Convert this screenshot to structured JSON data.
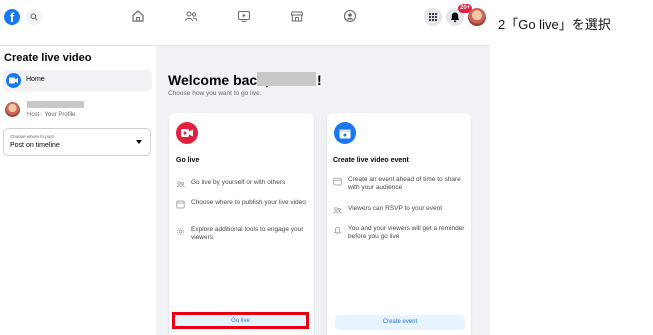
{
  "header": {
    "brand_letter": "f",
    "notification_count": "20+",
    "icons": [
      "facebook-logo-icon",
      "search-icon",
      "home-icon",
      "friends-icon",
      "watch-icon",
      "marketplace-icon",
      "groups-icon",
      "menu-grid-icon",
      "messenger-icon",
      "notifications-icon",
      "account-avatar"
    ]
  },
  "annotation": "2「Go live」を選択",
  "sidebar": {
    "title": "Create live video",
    "home_label": "Home",
    "host_label": "Host · Your Profile",
    "post_select": {
      "small_label": "Choose where to post",
      "value": "Post on timeline"
    }
  },
  "main": {
    "welcome_text": "Welcome back,",
    "welcome_suffix": "!",
    "welcome_sub": "Choose how you want to go live.",
    "go_live_card": {
      "title": "Go live",
      "features": [
        "Go live by yourself or with others",
        "Choose where to publish your live video",
        "Explore additional tools to engage your viewers"
      ],
      "button": "Go live"
    },
    "event_card": {
      "title": "Create live video event",
      "features": [
        "Create an event ahead of time to share with your audience",
        "Viewers can RSVP to your event",
        "You and your viewers will get a reminder before you go live"
      ],
      "button": "Create event"
    }
  },
  "colors": {
    "accent": "#1877f2",
    "go_live_icon": "#e41e3f",
    "highlight": "#e60012",
    "button_bg": "#e7f3ff"
  }
}
